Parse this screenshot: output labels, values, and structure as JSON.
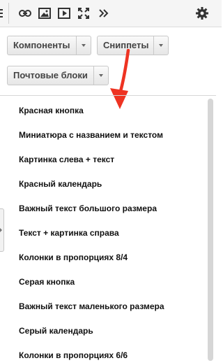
{
  "toolbar": {
    "icons": [
      "list-icon",
      "link-icon",
      "image-icon",
      "video-icon",
      "fullscreen-icon",
      "more-icon",
      "gear-icon"
    ]
  },
  "buttons": {
    "components": "Компоненты",
    "snippets": "Сниппеты",
    "mail_blocks": "Почтовые блоки"
  },
  "snippets": [
    "Красная кнопка",
    "Миниатюра с названием и текстом",
    "Картинка слева + текст",
    "Красный календарь",
    "Важный текст большого размера",
    "Текст + картинка справа",
    "Колонки в пропорциях 8/4",
    "Серая кнопка",
    "Важный текст маленького размера",
    "Серый календарь",
    "Колонки в пропорциях 6/6"
  ],
  "colors": {
    "arrow": "#ee3322",
    "toolbar_bg": "#f5f5f5"
  }
}
